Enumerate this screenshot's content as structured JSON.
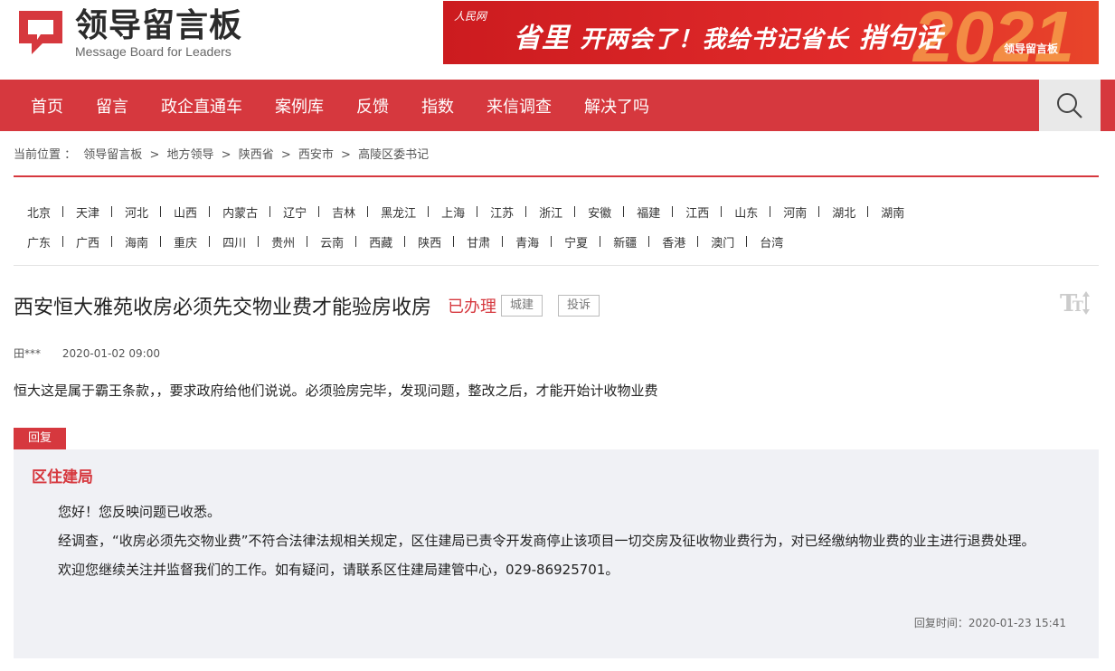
{
  "header": {
    "logo_title": "领导留言板",
    "logo_subtitle": "Message Board for Leaders",
    "banner": {
      "brand": "人民网",
      "headline_a": "省里",
      "headline_b": "开两会了！我给书记省长",
      "headline_c": "捎句话",
      "year": "2021",
      "brand_small": "领导留言板"
    }
  },
  "nav": {
    "items": [
      "首页",
      "留言",
      "政企直通车",
      "案例库",
      "反馈",
      "指数",
      "来信调查",
      "解决了吗"
    ],
    "search_icon": "search-icon"
  },
  "breadcrumb": {
    "prefix": "当前位置 ：",
    "items": [
      "领导留言板",
      "地方领导",
      "陕西省",
      "西安市",
      "高陵区委书记"
    ],
    "separator": ">"
  },
  "regions": {
    "row1": [
      "北京",
      "天津",
      "河北",
      "山西",
      "内蒙古",
      "辽宁",
      "吉林",
      "黑龙江",
      "上海",
      "江苏",
      "浙江",
      "安徽",
      "福建",
      "江西",
      "山东",
      "河南",
      "湖北",
      "湖南"
    ],
    "row2": [
      "广东",
      "广西",
      "海南",
      "重庆",
      "四川",
      "贵州",
      "云南",
      "西藏",
      "陕西",
      "甘肃",
      "青海",
      "宁夏",
      "新疆",
      "香港",
      "澳门",
      "台湾"
    ]
  },
  "message": {
    "title": "西安恒大雅苑收房必须先交物业费才能验房收房",
    "status": "已办理",
    "tags": [
      "城建",
      "投诉"
    ],
    "author": "田***",
    "date": "2020-01-02 09:00",
    "content": "恒大这是属于霸王条款，，要求政府给他们说说。必须验房完毕，发现问题，整改之后，才能开始计收物业费"
  },
  "reply": {
    "tab_label": "回复",
    "org": "区住建局",
    "paragraphs": [
      "您好！您反映问题已收悉。",
      "经调查，“收房必须先交物业费”不符合法律法规相关规定，区住建局已责令开发商停止该项目一切交房及征收物业费行为，对已经缴纳物业费的业主进行退费处理。",
      "欢迎您继续关注并监督我们的工作。如有疑问，请联系区住建局建管中心，029-86925701。"
    ],
    "time_label": "回复时间：2020-01-23 15:41"
  },
  "colors": {
    "accent": "#d6383e",
    "reply_bg": "#f0f1f5"
  }
}
